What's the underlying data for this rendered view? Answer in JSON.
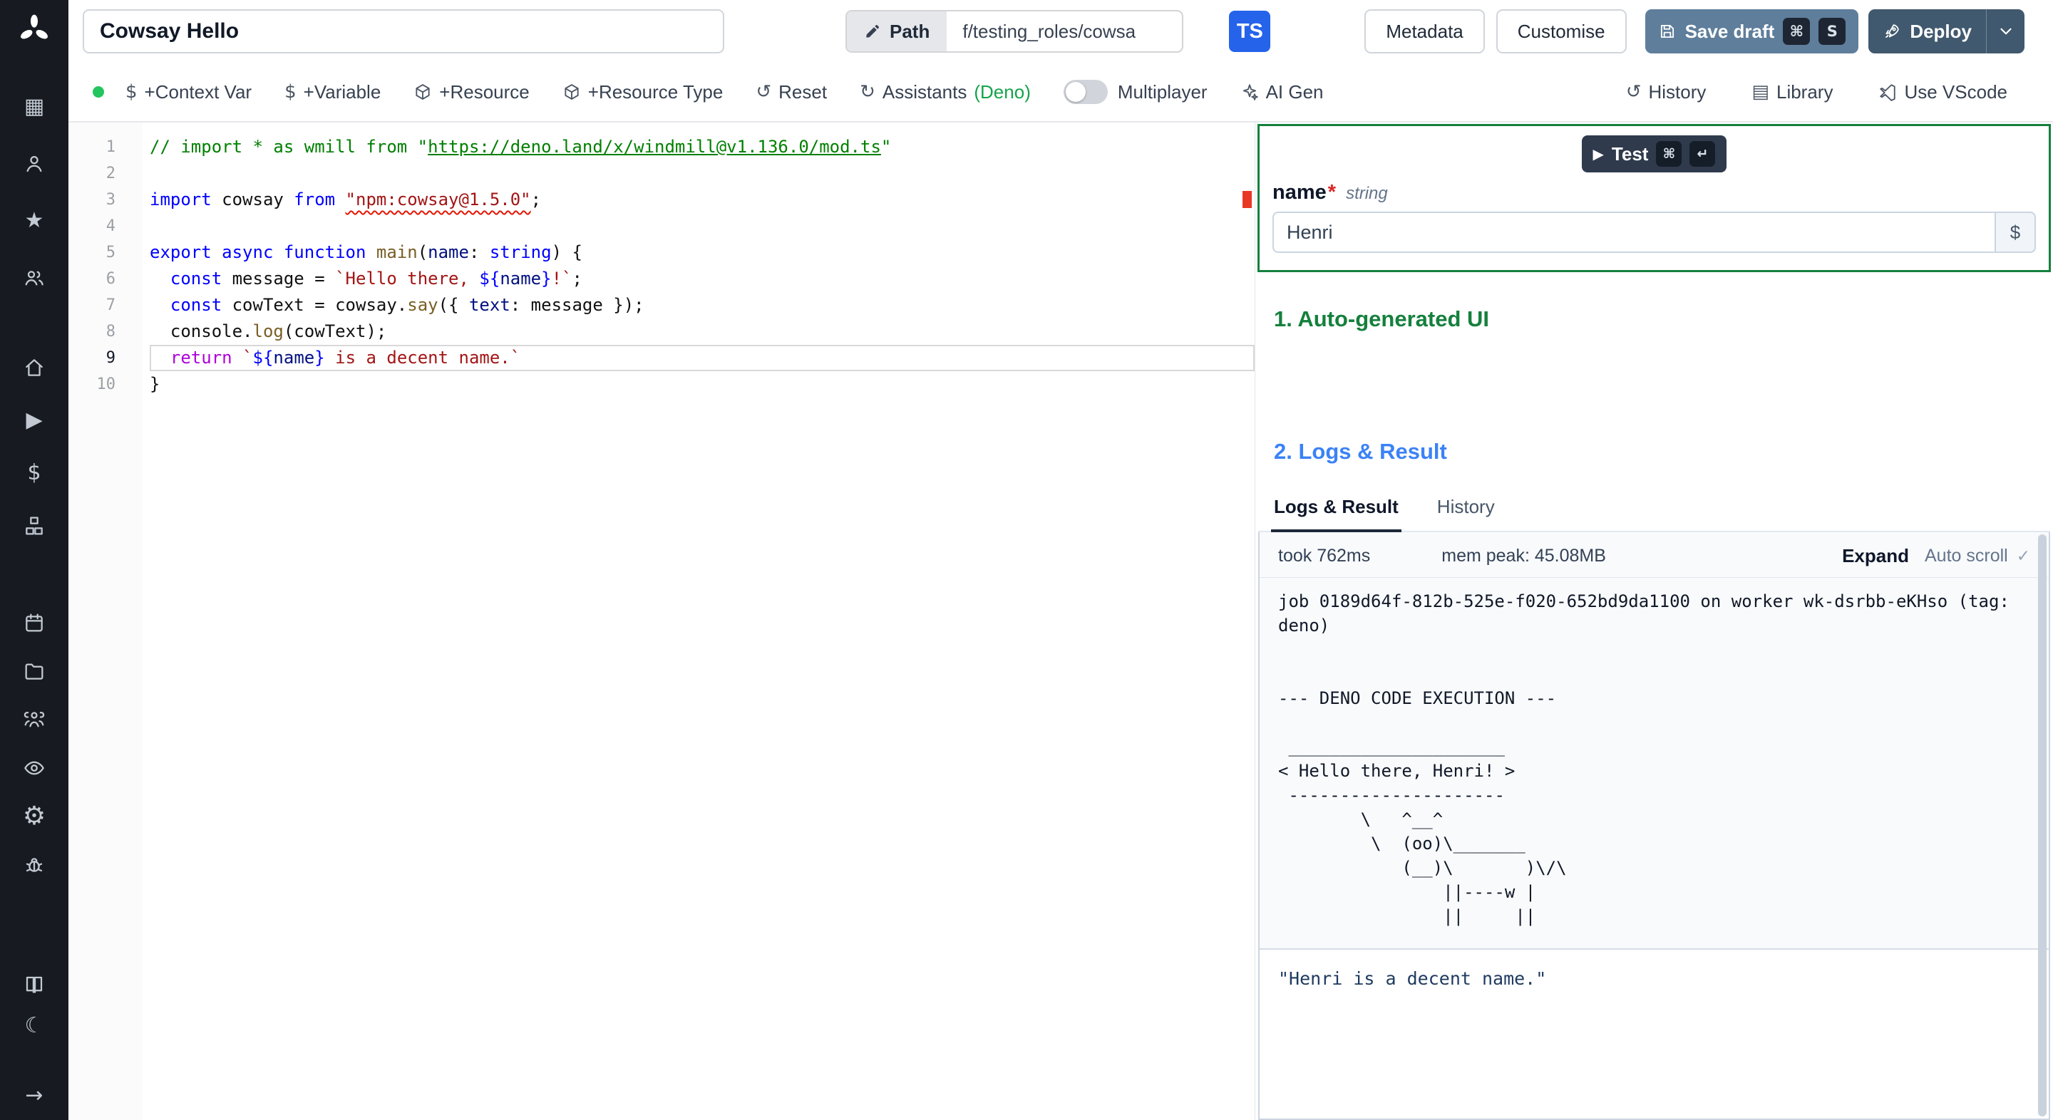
{
  "topbar": {
    "script_name": "Cowsay Hello",
    "path_label": "Path",
    "path_value": "f/testing_roles/cowsa",
    "lang_badge": "TS",
    "metadata": "Metadata",
    "customise": "Customise",
    "save_draft": "Save draft",
    "kbd_cmd": "⌘",
    "kbd_s": "S",
    "deploy": "Deploy"
  },
  "toolbar": {
    "context_var": "+Context Var",
    "variable": "+Variable",
    "resource": "+Resource",
    "resource_type": "+Resource Type",
    "reset": "Reset",
    "assistants": "Assistants",
    "assistants_lang": "(Deno)",
    "multiplayer": "Multiplayer",
    "ai_gen": "AI Gen",
    "history": "History",
    "library": "Library",
    "vscode": "Use VScode"
  },
  "icons": {
    "dollar": "$",
    "reset": "↺",
    "assistants": "↻",
    "history": "↺",
    "library": "▤",
    "grid": "▦",
    "star": "★",
    "play": "▶",
    "gear": "⚙",
    "moon": "☾",
    "arrow": "→",
    "check": "✓",
    "test_play": "▶"
  },
  "editor": {
    "active_line": 9,
    "lines": [
      [
        [
          "cm",
          "// import * as wmill from \""
        ],
        [
          "lk",
          "https://deno.land/x/windmill@v1.136.0/mod.ts"
        ],
        [
          "cm",
          "\""
        ]
      ],
      [],
      [
        [
          "kw",
          "import"
        ],
        [
          "df",
          " cowsay "
        ],
        [
          "kw",
          "from"
        ],
        [
          "df",
          " "
        ],
        [
          "sq",
          "\"npm:cowsay@1.5.0\""
        ],
        [
          "df",
          ";"
        ]
      ],
      [],
      [
        [
          "kw",
          "export"
        ],
        [
          "df",
          " "
        ],
        [
          "kw",
          "async"
        ],
        [
          "df",
          " "
        ],
        [
          "kw",
          "function"
        ],
        [
          "df",
          " "
        ],
        [
          "fn",
          "main"
        ],
        [
          "df",
          "("
        ],
        [
          "vr",
          "name"
        ],
        [
          "df",
          ": "
        ],
        [
          "kw",
          "string"
        ],
        [
          "df",
          ") {"
        ]
      ],
      [
        [
          "df",
          "  "
        ],
        [
          "kw",
          "const"
        ],
        [
          "df",
          " message = "
        ],
        [
          "st",
          "`Hello there, "
        ],
        [
          "kw",
          "${"
        ],
        [
          "vr",
          "name"
        ],
        [
          "kw",
          "}"
        ],
        [
          "st",
          "!`"
        ],
        [
          "df",
          ";"
        ]
      ],
      [
        [
          "df",
          "  "
        ],
        [
          "kw",
          "const"
        ],
        [
          "df",
          " cowText = cowsay."
        ],
        [
          "fn",
          "say"
        ],
        [
          "df",
          "({ "
        ],
        [
          "vr",
          "text"
        ],
        [
          "df",
          ": message });"
        ]
      ],
      [
        [
          "df",
          "  console."
        ],
        [
          "fn",
          "log"
        ],
        [
          "df",
          "(cowText);"
        ]
      ],
      [
        [
          "df",
          "  "
        ],
        [
          "ct",
          "return"
        ],
        [
          "df",
          " "
        ],
        [
          "st",
          "`"
        ],
        [
          "kw",
          "${"
        ],
        [
          "vr",
          "name"
        ],
        [
          "kw",
          "}"
        ],
        [
          "st",
          " is a decent name.`"
        ]
      ],
      [
        [
          "df",
          "}"
        ]
      ]
    ]
  },
  "run_panel": {
    "test": "Test",
    "kbd_cmd": "⌘",
    "kbd_enter": "↵",
    "field_name": "name",
    "required_mark": "*",
    "field_type": "string",
    "field_value": "Henri",
    "dollar": "$",
    "section1": "1. Auto-generated UI",
    "section2": "2. Logs & Result",
    "tab_logs": "Logs & Result",
    "tab_history": "History",
    "took": "took 762ms",
    "mem": "mem peak: 45.08MB",
    "expand": "Expand",
    "autoscroll": "Auto scroll",
    "log_text": "job 0189d64f-812b-525e-f020-652bd9da1100 on worker wk-dsrbb-eKHso (tag: deno)\n\n\n--- DENO CODE EXECUTION ---\n\n _____________________\n< Hello there, Henri! >\n ---------------------\n        \\   ^__^\n         \\  (oo)\\_______\n            (__)\\       )\\/\\\n                ||----w |\n                ||     ||",
    "result_text": "\"Henri is a decent name.\""
  },
  "colors": {
    "accent_green": "#15803d",
    "accent_blue": "#3b82f6",
    "ts_blue": "#2563eb",
    "save_draft_bg": "#5e7e9b",
    "deploy_bg": "#41596e",
    "status_dot": "#22c55e",
    "error_red": "#e51400"
  }
}
